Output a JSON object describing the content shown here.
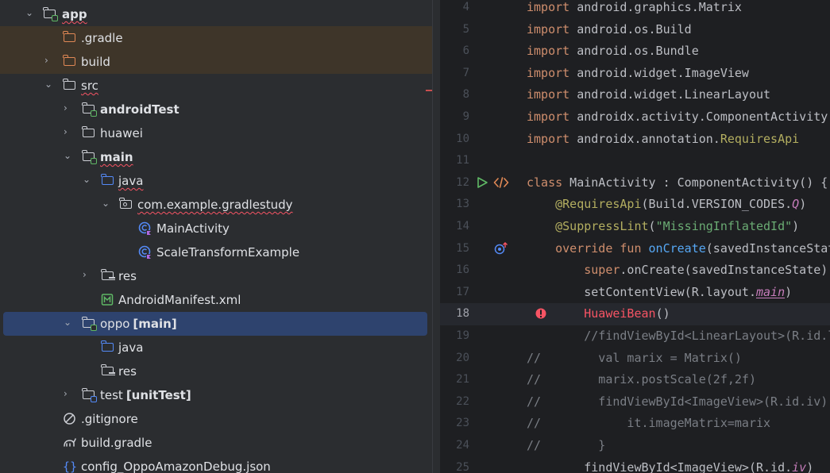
{
  "tree": {
    "items": [
      {
        "label": "app",
        "suffix": ""
      },
      {
        "label": ".gradle",
        "suffix": ""
      },
      {
        "label": "build",
        "suffix": ""
      },
      {
        "label": "src",
        "suffix": ""
      },
      {
        "label": "androidTest",
        "suffix": ""
      },
      {
        "label": "huawei",
        "suffix": ""
      },
      {
        "label": "main",
        "suffix": ""
      },
      {
        "label": "java",
        "suffix": ""
      },
      {
        "label": "com.example.gradlestudy",
        "suffix": ""
      },
      {
        "label": "MainActivity",
        "suffix": ""
      },
      {
        "label": "ScaleTransformExample",
        "suffix": ""
      },
      {
        "label": "res",
        "suffix": ""
      },
      {
        "label": "AndroidManifest.xml",
        "suffix": ""
      },
      {
        "label": "oppo",
        "suffix": "[main]"
      },
      {
        "label": "java",
        "suffix": ""
      },
      {
        "label": "res",
        "suffix": ""
      },
      {
        "label": "test",
        "suffix": "[unitTest]"
      },
      {
        "label": ".gitignore",
        "suffix": ""
      },
      {
        "label": "build.gradle",
        "suffix": ""
      },
      {
        "label": "config_OppoAmazonDebug.json",
        "suffix": ""
      }
    ]
  },
  "editor": {
    "current_line": "18",
    "lines": [
      {
        "num": "4",
        "code": [
          "import",
          " android.graphics.Matrix"
        ]
      },
      {
        "num": "5",
        "code": [
          "import",
          " android.os.Build"
        ]
      },
      {
        "num": "6",
        "code": [
          "import",
          " android.os.Bundle"
        ]
      },
      {
        "num": "7",
        "code": [
          "import",
          " android.widget.ImageView"
        ]
      },
      {
        "num": "8",
        "code": [
          "import",
          " android.widget.LinearLayout"
        ]
      },
      {
        "num": "9",
        "code": [
          "import",
          " androidx.activity.ComponentActivity"
        ]
      },
      {
        "num": "10",
        "code": [
          "import",
          " androidx.annotation.",
          "RequiresApi"
        ]
      },
      {
        "num": "11",
        "code": []
      },
      {
        "num": "12",
        "code": [
          "class",
          " MainActivity : ComponentActivity() {"
        ]
      },
      {
        "num": "13",
        "code": [
          "    ",
          "@RequiresApi",
          "(Build.VERSION_CODES.",
          "Q",
          ")"
        ]
      },
      {
        "num": "14",
        "code": [
          "    ",
          "@SuppressLint",
          "(",
          "\"MissingInflatedId\"",
          ")"
        ]
      },
      {
        "num": "15",
        "code": [
          "    ",
          "override fun",
          " ",
          "onCreate",
          "(savedInstanceState: Bundle?) {"
        ]
      },
      {
        "num": "16",
        "code": [
          "        ",
          "super",
          ".onCreate(savedInstanceState)"
        ]
      },
      {
        "num": "17",
        "code": [
          "        setContentView(R.layout.",
          "main",
          ")"
        ]
      },
      {
        "num": "18",
        "code": [
          "        ",
          "HuaweiBean",
          "()"
        ]
      },
      {
        "num": "19",
        "code": [
          "        //findViewById<LinearLayout>(R.id.ll)"
        ]
      },
      {
        "num": "20",
        "code": [
          "//        val marix = Matrix()"
        ]
      },
      {
        "num": "21",
        "code": [
          "//        marix.postScale(2f,2f)"
        ]
      },
      {
        "num": "22",
        "code": [
          "//        findViewById<ImageView>(R.id.iv).apply {"
        ]
      },
      {
        "num": "23",
        "code": [
          "//            it.imageMatrix=marix"
        ]
      },
      {
        "num": "24",
        "code": [
          "//        }"
        ]
      },
      {
        "num": "25",
        "code": [
          "        findViewById<ImageView>(R.id.",
          "iv",
          ")"
        ]
      }
    ]
  }
}
